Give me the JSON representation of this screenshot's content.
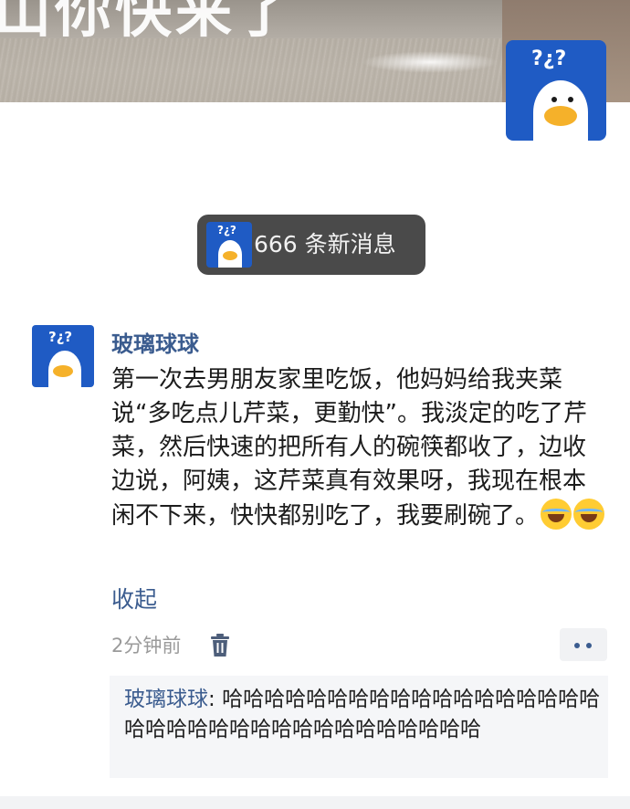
{
  "banner": {
    "overlay_text": "山你快来了"
  },
  "notification": {
    "text": "666 条新消息"
  },
  "post": {
    "author": "玻璃球球",
    "text": "第一次去男朋友家里吃饭，他妈妈给我夹菜说“多吃点儿芹菜，更勤快”。我淡定的吃了芹菜，然后快速的把所有人的碗筷都收了，边收边说，阿姨，这芹菜真有效果呀，我现在根本闲不下来，快快都别吃了，我要刷碗了。",
    "emoji": [
      "laughing-tears-emoji",
      "laughing-tears-emoji"
    ],
    "collapse_label": "收起",
    "time": "2分钟前"
  },
  "comment": {
    "user": "玻璃球球",
    "separator": ": ",
    "text": "哈哈哈哈哈哈哈哈哈哈哈哈哈哈哈哈哈哈哈哈哈哈哈哈哈哈哈哈哈哈哈哈哈哈哈"
  },
  "avatar": {
    "label": "?¿?",
    "color": "#1f5bc4"
  },
  "colors": {
    "link": "#3b5c8f",
    "pill_bg": "#4a4a4a",
    "text": "#1c1c1c",
    "muted": "#9a9a9a"
  }
}
